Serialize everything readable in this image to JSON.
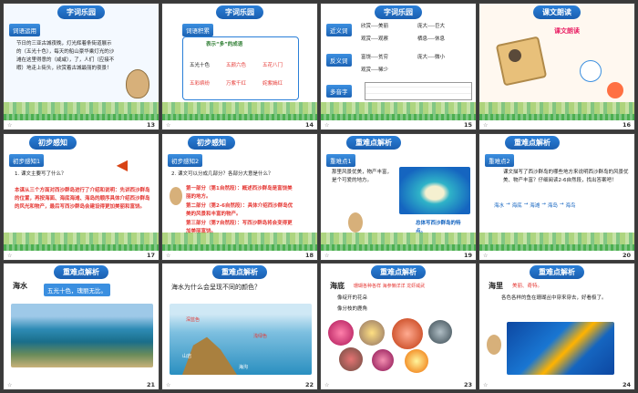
{
  "slides": [
    {
      "num": "13",
      "title": "字词乐园",
      "tag": "词语运用",
      "body": "节日的三亚古城夜晚，灯光辉着条街道展示的（五光十色），每天的船山豪华乘灯光的沙滩在这里得意的（咸咸），了，人们（应接不暇）地走上街头，欣赏着古城最丽的夜景！"
    },
    {
      "num": "14",
      "title": "字词乐园",
      "tag": "词语积累",
      "subtitle": "表示“多”的成语",
      "idioms": [
        "五光十色",
        "五颜六色",
        "五花八门",
        "五彩缤纷",
        "万紫千红",
        "姹紫嫣红"
      ]
    },
    {
      "num": "15",
      "title": "字词乐园",
      "sections": [
        {
          "tag": "近义词",
          "pairs": [
            "欣赏----美丽",
            "庞大----巨大",
            "观赏----观察",
            "栖息----休息"
          ]
        },
        {
          "tag": "反义词",
          "pairs": [
            "富饶----贫穷",
            "庞大----微小",
            "观赏----稀少"
          ]
        },
        {
          "tag": "多音字"
        }
      ]
    },
    {
      "num": "16",
      "title": "课文朗读",
      "label": "课文朗读"
    },
    {
      "num": "17",
      "title": "初步感知",
      "tag": "初步感知1",
      "question": "1. 课文主要写了什么？",
      "answer": "本课从三个方面对西沙群岛进行了介绍和说明：先讲西沙群岛的位置，再按海面、海底海滩、海岛的顺序具体介绍西沙群岛的风光和物产，最后写西沙群岛会建设得更加美丽和富饶。"
    },
    {
      "num": "18",
      "title": "初步感知",
      "tag": "初步感知2",
      "question": "2. 课文可以分成几部分？各部分大意是什么？",
      "parts": [
        "第一部分（第1自然段）：概述西沙群岛是富饶美丽的地方。",
        "第二部分（第2-6自然段）：具体介绍西沙群岛优美的风景和丰富的物产。",
        "第三部分（第7自然段）：写西沙群岛将会变得更加美丽富饶。"
      ]
    },
    {
      "num": "19",
      "title": "重难点解析",
      "tag": "重难点1",
      "body": "那里风景优美，物产丰富，是个可爱的地方。",
      "caption": "总体写西沙群岛的特点。"
    },
    {
      "num": "20",
      "title": "重难点解析",
      "tag": "重难点2",
      "body": "课文描写了西沙群岛的哪些地方来说明西沙群岛的风景优美、物产丰富？仔细阅读2-6自然段，找出答案吧！",
      "flow": [
        "海水",
        "海底",
        "海滩",
        "海岛",
        "海鸟"
      ]
    },
    {
      "num": "21",
      "title": "重难点解析",
      "heading": "海水",
      "note": "五光十色，瑰丽无比。"
    },
    {
      "num": "22",
      "title": "重难点解析",
      "question": "海水为什么会呈现不同的颜色？",
      "labels": [
        "深蓝色",
        "浅绿色",
        "山岩",
        "海沟"
      ]
    },
    {
      "num": "23",
      "title": "重难点解析",
      "heading": "海底",
      "note": "珊瑚各种各样 海参懒洋洋 龙虾威武",
      "lines": [
        "像绽开的花朵",
        "像分枝的鹿角"
      ]
    },
    {
      "num": "24",
      "title": "重难点解析",
      "heading": "海里",
      "note": "美丽、奇特。",
      "body": "各色各样的鱼在珊瑚丛中穿来穿去，好看极了。"
    }
  ]
}
